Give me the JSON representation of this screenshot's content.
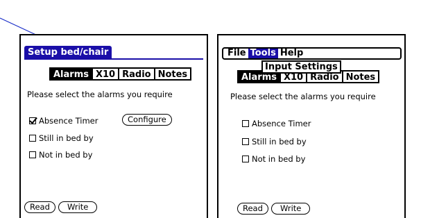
{
  "left_screen": {
    "title": "Setup bed/chair",
    "tabs": [
      {
        "label": "Alarms",
        "selected": true
      },
      {
        "label": "X10",
        "selected": false
      },
      {
        "label": "Radio",
        "selected": false
      },
      {
        "label": "Notes",
        "selected": false
      }
    ],
    "prompt": "Please select the alarms you require",
    "options": [
      {
        "label": "Absence Timer",
        "checked": true
      },
      {
        "label": "Still in bed by",
        "checked": false
      },
      {
        "label": "Not in bed by",
        "checked": false
      }
    ],
    "configure_label": "Configure",
    "read_label": "Read",
    "write_label": "Write"
  },
  "right_screen": {
    "menu": [
      {
        "label": "File",
        "active": false
      },
      {
        "label": "Tools",
        "active": true
      },
      {
        "label": "Help",
        "active": false
      }
    ],
    "dropdown_item": "Input Settings",
    "tabs": [
      {
        "label": "Alarms",
        "selected": true
      },
      {
        "label": "X10",
        "selected": false
      },
      {
        "label": "Radio",
        "selected": false
      },
      {
        "label": "Notes",
        "selected": false
      }
    ],
    "prompt": "Please select the alarms you require",
    "options": [
      {
        "label": "Absence Timer",
        "checked": false
      },
      {
        "label": "Still in bed by",
        "checked": false
      },
      {
        "label": "Not in bed by",
        "checked": false
      }
    ],
    "read_label": "Read",
    "write_label": "Write"
  },
  "colors": {
    "accent": "#1a0ea8",
    "annotation_arrow": "#1a2ec8"
  }
}
